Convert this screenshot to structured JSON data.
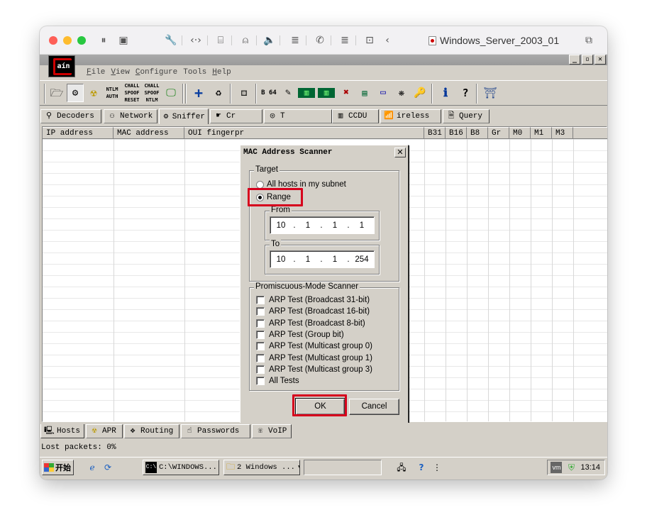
{
  "host": {
    "vm_title": "Windows_Server_2003_01"
  },
  "window": {
    "min_glyph": "_",
    "restore_glyph": "▫",
    "close_glyph": "✕"
  },
  "app": {
    "logo_text": "aín",
    "menu": {
      "file": {
        "u": "F",
        "rest": "ile"
      },
      "view": {
        "u": "V",
        "rest": "iew"
      },
      "configure": {
        "u": "C",
        "rest": "onfigure"
      },
      "tools": {
        "u": "",
        "rest": "Tools"
      },
      "help": {
        "u": "H",
        "rest": "elp"
      }
    },
    "toolbar_labels": {
      "ntlm_auth": "NTLM AUTH",
      "chall_spoof_reset": "CHALL SPOOF RESET",
      "chall_spoof_ntlm": "CHALL SPOOF NTLM",
      "b64": "B 64"
    },
    "tabs_top": [
      "Decoders",
      "Network",
      "Sniffer",
      "Cr",
      "T",
      "CCDU",
      "ireless",
      "Query"
    ],
    "columns": [
      "IP address",
      "MAC address",
      "OUI fingerpr",
      "B31",
      "B16",
      "B8",
      "Gr",
      "M0",
      "M1",
      "M3"
    ],
    "tabs_bottom": [
      "Hosts",
      "APR",
      "Routing",
      "Passwords",
      "VoIP"
    ],
    "status": "Lost packets:  0%"
  },
  "dialog": {
    "title": "MAC Address Scanner",
    "close_glyph": "✕",
    "target_group": "Target",
    "opt_subnet": "All hosts in my subnet",
    "opt_range": "Range",
    "range_selected": true,
    "from_label": "From",
    "from_ip": [
      "10",
      "1",
      "1",
      "1"
    ],
    "to_label": "To",
    "to_ip": [
      "10",
      "1",
      "1",
      "254"
    ],
    "promisc_group": "Promiscuous-Mode Scanner",
    "tests": [
      "ARP Test (Broadcast 31-bit)",
      "ARP Test (Broadcast 16-bit)",
      "ARP Test (Broadcast 8-bit)",
      "ARP Test (Group bit)",
      "ARP Test (Multicast group 0)",
      "ARP Test (Multicast group 1)",
      "ARP Test (Multicast group 3)",
      "All Tests"
    ],
    "ok": "OK",
    "cancel": "Cancel"
  },
  "taskbar": {
    "start": "开始",
    "cmd": "C:\\WINDOWS...",
    "explorer": "2 Windows ...",
    "clock": "13:14"
  },
  "colors": {
    "highlight": "#d6001c",
    "win_face": "#d4d0c8"
  }
}
